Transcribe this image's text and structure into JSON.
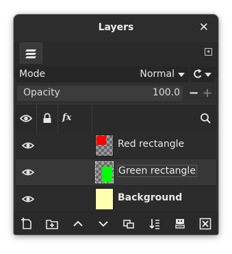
{
  "window": {
    "title": "Layers",
    "close_icon": "close-icon"
  },
  "tabs": {
    "active_tab_icon": "layers-stack-icon",
    "menu_icon": "tab-menu-icon"
  },
  "mode": {
    "label": "Mode",
    "value": "Normal",
    "switch_icon": "composite-mode-icon"
  },
  "opacity": {
    "label": "Opacity",
    "value": "100.0",
    "decrement": "−",
    "increment": "+"
  },
  "header": {
    "icons": [
      "visibility-icon",
      "lock-icon",
      "effects-icon",
      "search-icon"
    ],
    "fx_label": "fx"
  },
  "layers": [
    {
      "name": "Red rectangle",
      "visible": true,
      "thumb_color": "#ff0000",
      "bold": false,
      "active": false
    },
    {
      "name": "Green rectangle",
      "visible": true,
      "thumb_color": "#00ff00",
      "bold": false,
      "active": true
    },
    {
      "name": "Background",
      "visible": true,
      "thumb_color": "#ffffb0",
      "bold": true,
      "active": false
    }
  ],
  "footer_buttons": [
    "new-layer-icon",
    "new-group-icon",
    "raise-layer-icon",
    "lower-layer-icon",
    "duplicate-layer-icon",
    "merge-down-icon",
    "mask-icon",
    "delete-layer-icon"
  ],
  "colors": {
    "panel_bg": "#303030",
    "text": "#e8e8e8",
    "active_row": "#373737"
  }
}
